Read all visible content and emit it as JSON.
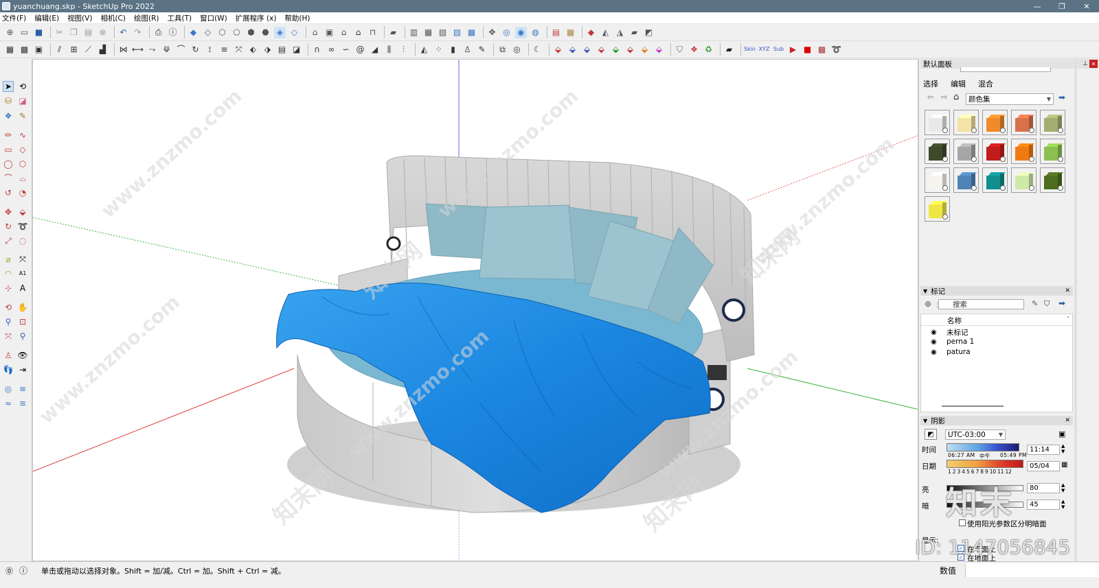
{
  "window": {
    "title": "yuanchuang.skp - SketchUp Pro 2022",
    "min": "—",
    "max": "❐",
    "close": "✕"
  },
  "menu": [
    "文件(F)",
    "编辑(E)",
    "视图(V)",
    "相机(C)",
    "绘图(R)",
    "工具(T)",
    "窗口(W)",
    "扩展程序 (x)",
    "帮助(H)"
  ],
  "watermark": {
    "site": "www.znzmo.com",
    "brand": "知末网",
    "logo": "知末",
    "id": "ID: 1147056845"
  },
  "panel": {
    "tray_title": "默认面板",
    "tabs": [
      "选择",
      "编辑",
      "混合"
    ],
    "collection": "颜色集",
    "tags_title": "标记",
    "search_placeholder": "搜索",
    "name_header": "名称",
    "tags": [
      "未标记",
      "perna 1",
      "patura"
    ],
    "shadows_title": "阴影",
    "timezone": "UTC-03:00",
    "time_label": "时间",
    "time_start": "06:27 AM",
    "time_noon": "中午",
    "time_end": "05:49 PM",
    "time_value": "11:14",
    "date_label": "日期",
    "months": "1 2 3 4 5 6 7 8 9 10 11 12",
    "date_value": "05/04",
    "light_label": "亮",
    "light_value": "80",
    "dark_label": "暗",
    "dark_value": "45",
    "sun_shading": "使用阳光参数区分明暗面",
    "display_label": "显示:",
    "on_faces": "在平面上",
    "on_ground": "在地面上"
  },
  "status": {
    "hint": "单击或拖动以选择对象。Shift = 加/减。Ctrl = 加。Shift + Ctrl = 减。",
    "measure_label": "数值"
  },
  "colors": {
    "blanket": "#1e8fe8",
    "frame": "#d9d9d9",
    "pillow": "#8fb9c6",
    "mattress": "#7ab5cf",
    "swatches": [
      "#e8e8e8",
      "#f3e3a4",
      "#f08a2a",
      "#d9714a",
      "#a4ad70",
      "#3d4a2a",
      "#a6a6a8",
      "#c21c1c",
      "#f07a12",
      "#8cc050",
      "#f6f4ee",
      "#4f84b7",
      "#118f8f",
      "#cfe9a7",
      "#4e6c1e",
      "#efe645"
    ]
  }
}
